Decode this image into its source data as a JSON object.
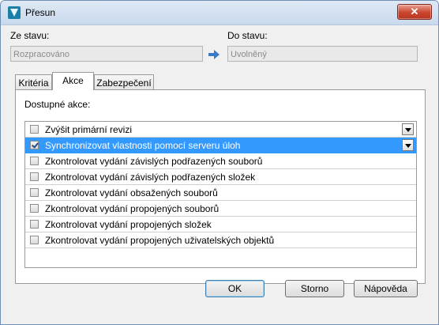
{
  "window": {
    "title": "Přesun",
    "close_label": "✕"
  },
  "from_state": {
    "label": "Ze stavu:",
    "value": "Rozpracováno"
  },
  "to_state": {
    "label": "Do stavu:",
    "value": "Uvolněný"
  },
  "tabs": [
    {
      "label": "Kritéria"
    },
    {
      "label": "Akce"
    },
    {
      "label": "Zabezpečení"
    }
  ],
  "actions_panel": {
    "label": "Dostupné akce:",
    "items": [
      {
        "label": "Zvýšit primární revizi",
        "checked": false,
        "has_dropdown": true
      },
      {
        "label": "Synchronizovat vlastnosti pomocí serveru úloh",
        "checked": true,
        "has_dropdown": true,
        "selected": true
      },
      {
        "label": "Zkontrolovat vydání závislých podřazených souborů",
        "checked": false
      },
      {
        "label": "Zkontrolovat vydání závislých podřazených složek",
        "checked": false
      },
      {
        "label": "Zkontrolovat vydání obsažených souborů",
        "checked": false
      },
      {
        "label": "Zkontrolovat vydání propojených souborů",
        "checked": false
      },
      {
        "label": "Zkontrolovat vydání propojených složek",
        "checked": false
      },
      {
        "label": "Zkontrolovat vydání propojených uživatelských objektů",
        "checked": false
      }
    ]
  },
  "buttons": {
    "ok": "OK",
    "cancel": "Storno",
    "help": "Nápověda"
  },
  "colors": {
    "selection": "#3399ff",
    "arrow": "#3a78c9",
    "close_button": "#c9452e"
  }
}
